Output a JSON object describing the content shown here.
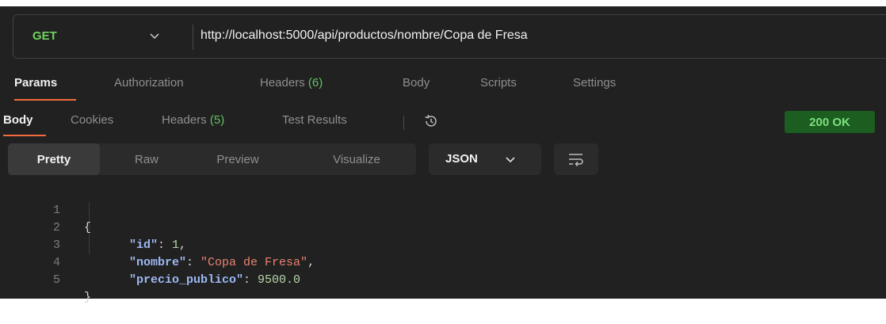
{
  "request": {
    "method": "GET",
    "url": "http://localhost:5000/api/productos/nombre/Copa de Fresa"
  },
  "request_tabs": [
    {
      "label": "Params",
      "active": true
    },
    {
      "label": "Authorization"
    },
    {
      "label": "Headers ",
      "count": "(6)"
    },
    {
      "label": "Body"
    },
    {
      "label": "Scripts"
    },
    {
      "label": "Settings"
    }
  ],
  "response_tabs": [
    {
      "label": "Body",
      "active": true
    },
    {
      "label": "Cookies"
    },
    {
      "label": "Headers ",
      "count": "(5)"
    },
    {
      "label": "Test Results"
    }
  ],
  "status": "200 OK",
  "view_modes": [
    "Pretty",
    "Raw",
    "Preview",
    "Visualize"
  ],
  "format": "JSON",
  "code_lines": [
    {
      "n": "1",
      "open": "{"
    },
    {
      "n": "2",
      "key": "\"id\"",
      "value": "1",
      "type": "num",
      "comma": ","
    },
    {
      "n": "3",
      "key": "\"nombre\"",
      "value": "\"Copa de Fresa\"",
      "type": "str",
      "comma": ","
    },
    {
      "n": "4",
      "key": "\"precio_publico\"",
      "value": "9500.0",
      "type": "num",
      "comma": ""
    },
    {
      "n": "5",
      "close": "}"
    }
  ],
  "colors": {
    "accent": "#f26b3a",
    "method": "#6fd35e",
    "status_bg": "#1b5e20",
    "status_text": "#7fe07f"
  },
  "icons": {
    "method_dropdown": "chevron-down-icon",
    "history": "history-icon",
    "format_dropdown": "chevron-down-icon",
    "wrap": "wrap-lines-icon"
  }
}
